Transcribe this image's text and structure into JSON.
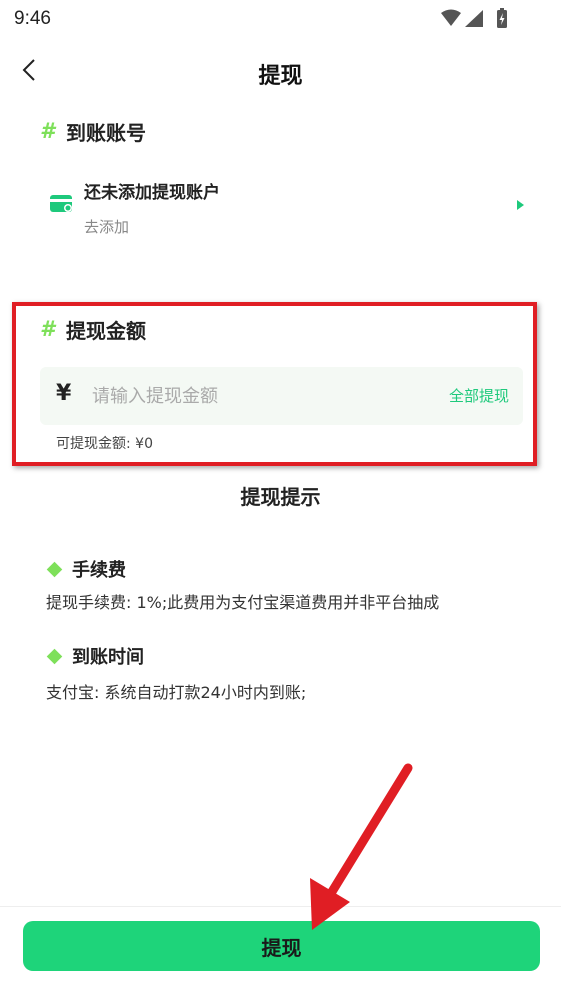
{
  "status_bar": {
    "time": "9:46",
    "icons": [
      "wifi-icon",
      "signal-icon",
      "battery-charging-icon"
    ]
  },
  "header": {
    "title": "提现",
    "back_icon": "chevron-left-icon"
  },
  "account_section": {
    "title": "到账账号",
    "account": {
      "title": "还未添加提现账户",
      "subtitle": "去添加",
      "icon": "card-icon"
    }
  },
  "amount_section": {
    "title": "提现金额",
    "currency": "¥",
    "placeholder": "请输入提现金额",
    "withdraw_all": "全部提现",
    "available_label": "可提现金额:",
    "available_value": "¥0"
  },
  "tips": {
    "title": "提现提示",
    "items": [
      {
        "title": "手续费",
        "body": "提现手续费: 1%;此费用为支付宝渠道费用并非平台抽成"
      },
      {
        "title": "到账时间",
        "body": "支付宝: 系统自动打款24小时内到账;"
      }
    ]
  },
  "submit": {
    "label": "提现"
  },
  "colors": {
    "accent": "#1ed47a",
    "hash": "#7ee05a",
    "highlight": "#e01e24"
  }
}
